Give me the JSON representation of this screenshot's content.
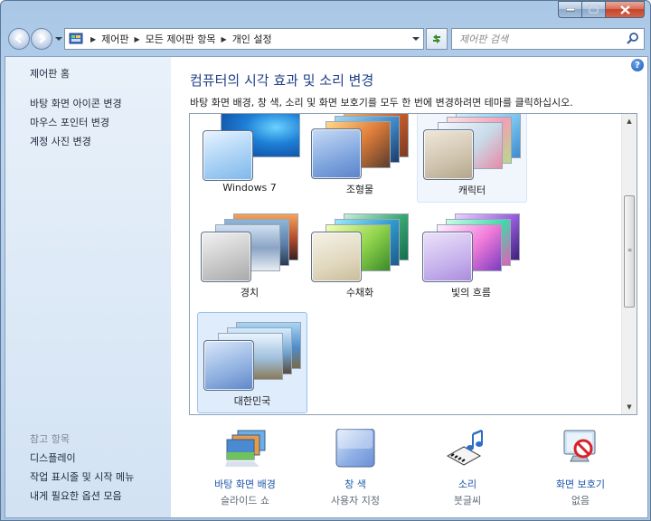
{
  "window": {
    "buttons": {
      "minimize": "—",
      "maximize": "□",
      "close": "✕"
    }
  },
  "address_bar": {
    "breadcrumbs": [
      "제어판",
      "모든 제어판 항목",
      "개인 설정"
    ],
    "search_placeholder": "제어판 검색"
  },
  "sidebar": {
    "home_link": "제어판 홈",
    "tasks": [
      "바탕 화면 아이콘 변경",
      "마우스 포인터 변경",
      "계정 사진 변경"
    ],
    "see_also_heading": "참고 항목",
    "see_also": [
      "디스플레이",
      "작업 표시줄 및 시작 메뉴",
      "내게 필요한 옵션 모음"
    ]
  },
  "main": {
    "title": "컴퓨터의 시각 효과 및 소리 변경",
    "subtitle": "바탕 화면 배경, 창 색, 소리 및 화면 보호기를 모두 한 번에 변경하려면 테마를 클릭하십시오.",
    "themes": [
      {
        "name": "Windows 7"
      },
      {
        "name": "조형물"
      },
      {
        "name": "캐릭터"
      },
      {
        "name": "경치"
      },
      {
        "name": "수채화"
      },
      {
        "name": "빛의 흐름"
      },
      {
        "name": "대한민국"
      }
    ],
    "bottom_items": [
      {
        "label": "바탕 화면 배경",
        "value": "슬라이드 쇼"
      },
      {
        "label": "창 색",
        "value": "사용자 지정"
      },
      {
        "label": "소리",
        "value": "붓글씨"
      },
      {
        "label": "화면 보호기",
        "value": "없음"
      }
    ]
  },
  "colors": {
    "link": "#1a55a8",
    "title": "#1e3f87",
    "sidebar_bg": "#dbe8f6",
    "selection": "#dfecfb"
  },
  "icons": [
    "back-icon",
    "forward-icon",
    "refresh-icon",
    "search-icon",
    "help-icon",
    "control-panel-icon",
    "desktop-background-icon",
    "window-color-icon",
    "sounds-icon",
    "screensaver-icon"
  ]
}
